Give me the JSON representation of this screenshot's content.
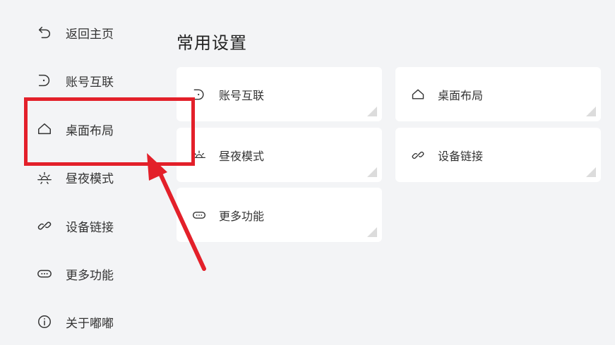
{
  "sidebar": {
    "items": [
      {
        "label": "返回主页",
        "icon": "back-arrow-icon"
      },
      {
        "label": "账号互联",
        "icon": "account-link-icon"
      },
      {
        "label": "桌面布局",
        "icon": "home-icon"
      },
      {
        "label": "昼夜模式",
        "icon": "sun-icon"
      },
      {
        "label": "设备链接",
        "icon": "link-icon"
      },
      {
        "label": "更多功能",
        "icon": "more-icon"
      },
      {
        "label": "关于嘟嘟",
        "icon": "info-icon"
      }
    ]
  },
  "main": {
    "title": "常用设置",
    "cards": [
      {
        "label": "账号互联",
        "icon": "account-link-icon"
      },
      {
        "label": "桌面布局",
        "icon": "home-icon"
      },
      {
        "label": "昼夜模式",
        "icon": "sun-icon"
      },
      {
        "label": "设备链接",
        "icon": "link-icon"
      },
      {
        "label": "更多功能",
        "icon": "more-icon"
      }
    ]
  },
  "annotation": {
    "color": "#e3202a"
  }
}
